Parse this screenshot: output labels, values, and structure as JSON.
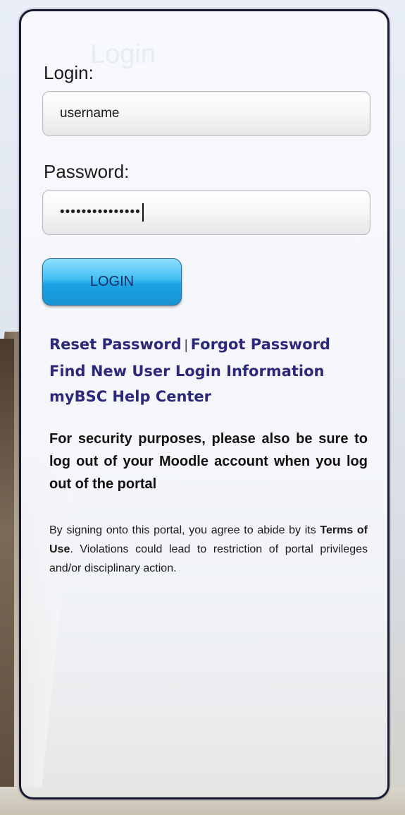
{
  "form": {
    "ghost_title": "Login",
    "login_label": "Login:",
    "username_value": "username",
    "password_label": "Password:",
    "password_value": "•••••••••••••••",
    "login_button": "LOGIN"
  },
  "links": {
    "reset_password": "Reset Password",
    "separator": "|",
    "forgot_password": "Forgot Password",
    "find_new_user": "Find New User Login Information",
    "help_center": "myBSC Help Center"
  },
  "notices": {
    "security": "For security purposes, please also be sure to log out of your Moodle account when you log out of the portal",
    "terms_prefix": "By signing onto this portal, you agree to abide by its ",
    "terms_link": "Terms of Use",
    "terms_suffix": ". Violations could lead to restriction of portal privileges and/or disciplinary action."
  },
  "colors": {
    "link": "#2b2a7a",
    "button_top": "#8fe0ff",
    "button_bottom": "#1893d3",
    "panel_border": "#1a1a33"
  }
}
